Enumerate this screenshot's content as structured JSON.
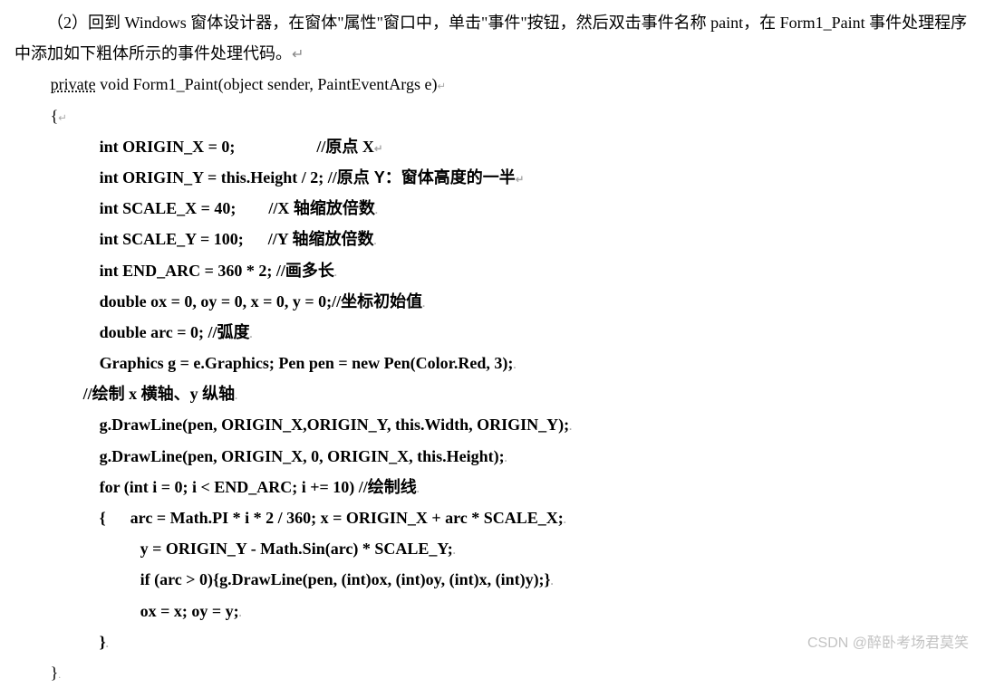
{
  "instruction": {
    "prefix": "（2）回到 Windows 窗体设计器，在窗体\"属性\"窗口中，单击\"事件\"按钮，然后双击事件名称 paint，在 Form1_Paint 事件处理程序中添加如下粗体所示的事件处理代码。",
    "return_mark": "↵"
  },
  "signature": {
    "keyword": "private",
    "rest": " void Form1_Paint(object sender, PaintEventArgs e)"
  },
  "braces": {
    "open": "{",
    "close": "}"
  },
  "code": {
    "l1a": "int ORIGIN_X = 0;                    //",
    "l1b": "原点",
    "l1c": " X",
    "l2a": "int ORIGIN_Y = this.Height / 2; //",
    "l2b": "原点",
    "l2c": " Y：窗体高度的一半",
    "l3a": "int SCALE_X = 40;        //X ",
    "l3b": "轴缩放倍数",
    "l4a": "int SCALE_Y = 100;      //Y ",
    "l4b": "轴缩放倍数",
    "l5a": "int END_ARC = 360 * 2; //",
    "l5b": "画多长",
    "l6a": "double ox = 0, oy = 0, x = 0, y = 0;//",
    "l6b": "坐标初始值",
    "l7a": "double arc = 0; //",
    "l7b": "弧度",
    "l8": "Graphics g = e.Graphics; Pen pen = new Pen(Color.Red, 3);",
    "c1a": "//",
    "c1b": "绘制",
    "c1c": " x ",
    "c1d": "横轴、",
    "c1e": "y ",
    "c1f": "纵轴",
    "l9": "g.DrawLine(pen, ORIGIN_X,ORIGIN_Y, this.Width, ORIGIN_Y);",
    "l10": "g.DrawLine(pen, ORIGIN_X, 0, ORIGIN_X, this.Height);",
    "l11a": "for (int i = 0; i < END_ARC; i += 10) //",
    "l11b": "绘制线",
    "loop_open": "{      arc = Math.PI * i * 2 / 360; x = ORIGIN_X + arc * SCALE_X;",
    "l12": "y = ORIGIN_Y - Math.Sin(arc) * SCALE_Y;",
    "l13": "if (arc > 0){g.DrawLine(pen, (int)ox, (int)oy, (int)x, (int)y);}",
    "l14": "ox = x; oy = y;",
    "loop_close": "}"
  },
  "tiny": {
    "dot": ".",
    "dot2": "↵",
    "small": "↵"
  },
  "watermark": "CSDN @醉卧考场君莫笑"
}
